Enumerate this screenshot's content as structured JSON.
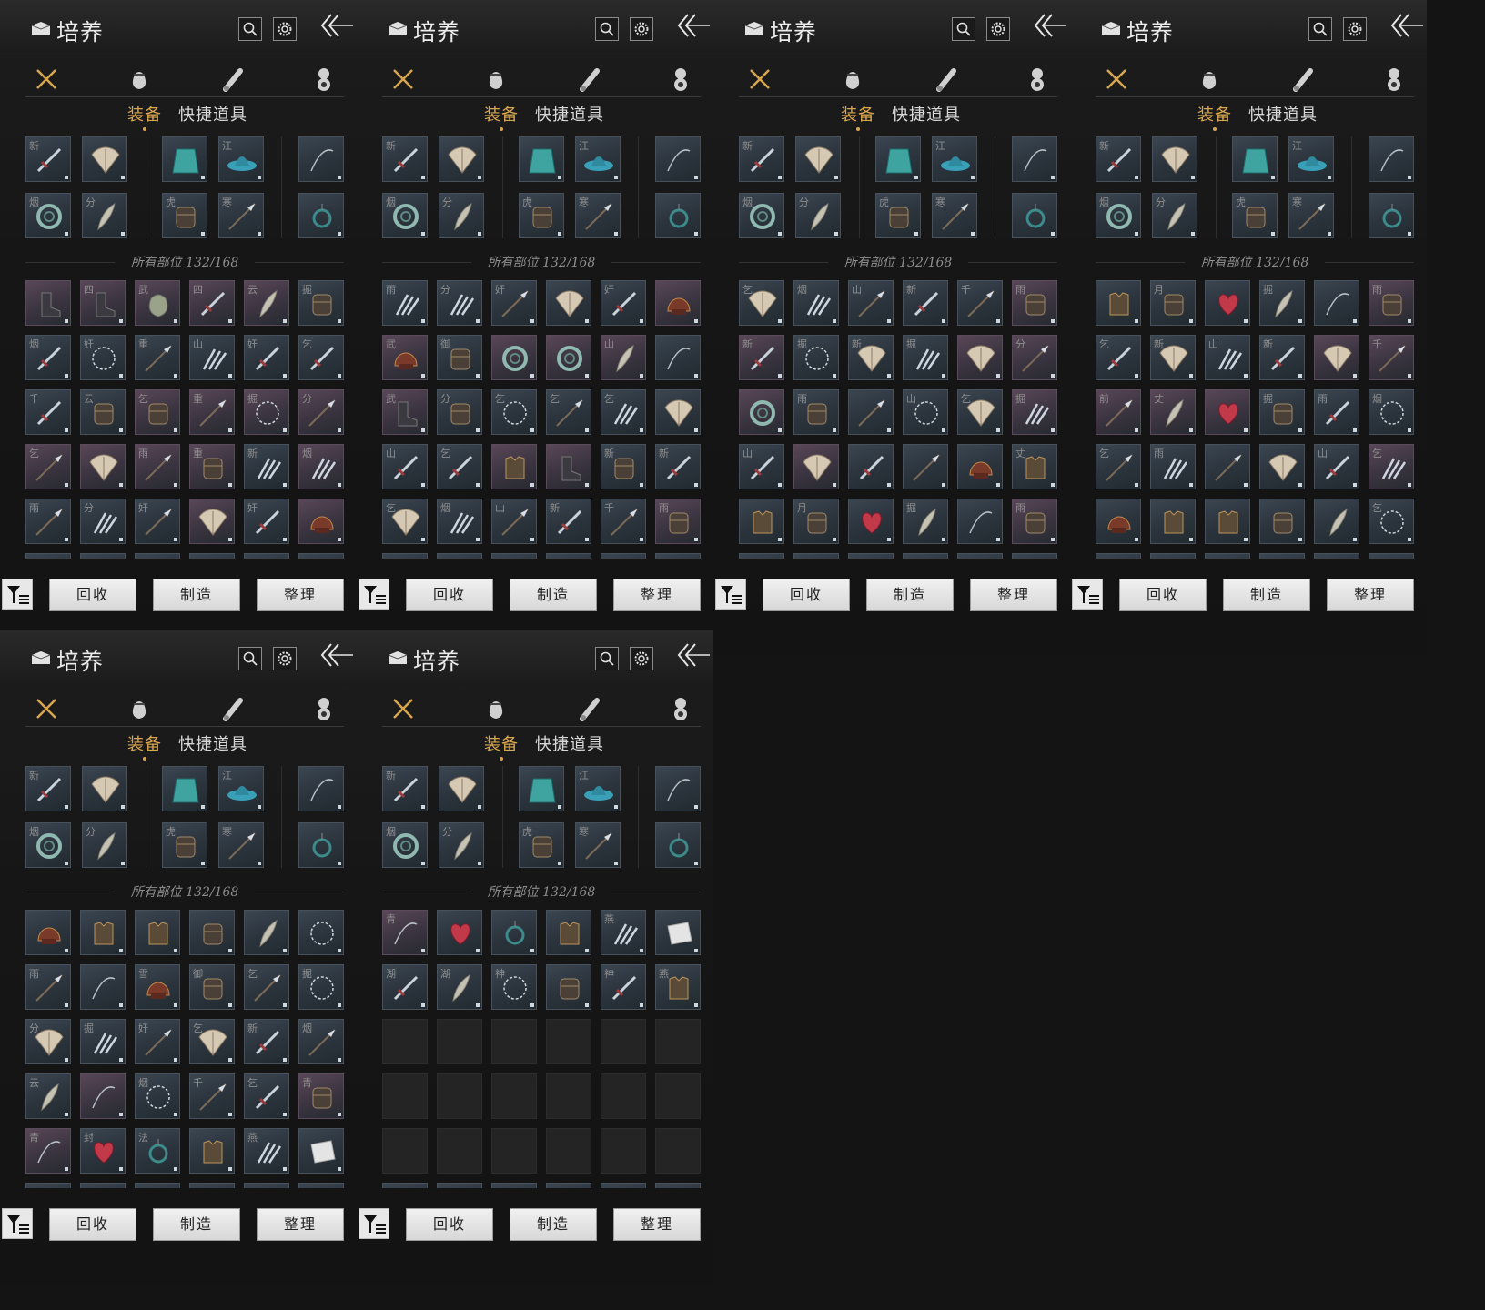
{
  "title": "培养",
  "category_tabs": [
    {
      "icon": "crossed-swords-icon",
      "active": true
    },
    {
      "icon": "pouch-icon",
      "active": false
    },
    {
      "icon": "scroll-icon",
      "active": false
    },
    {
      "icon": "emblem-icon",
      "active": false
    }
  ],
  "subtabs": {
    "equipment": "装备",
    "quick_items": "快捷道具"
  },
  "count_text": "所有部位 132/168",
  "buttons": {
    "recycle": "回收",
    "craft": "制造",
    "sort": "整理"
  },
  "colors": {
    "accent": "#d9a650",
    "slot_blue": "#3b4651",
    "slot_purple": "#5a4757"
  },
  "equipped_slots": [
    {
      "tag": "新",
      "icon": "sword-icon"
    },
    {
      "tag": "",
      "icon": "fan-icon"
    },
    {
      "tag": "",
      "icon": "cape-icon"
    },
    {
      "tag": "江",
      "icon": "hat-icon"
    },
    {
      "tag": "",
      "icon": "bow-icon"
    },
    {
      "tag": "烟",
      "icon": "ring-icon"
    },
    {
      "tag": "分",
      "icon": "feather-icon"
    },
    {
      "tag": "虎",
      "icon": "bracer-icon"
    },
    {
      "tag": "寒",
      "icon": "spear-icon"
    },
    {
      "tag": "",
      "icon": "amulet-icon"
    }
  ],
  "panels": [
    {
      "inventory": [
        {
          "t": "",
          "c": "p",
          "i": "boot-icon"
        },
        {
          "t": "四",
          "c": "p",
          "i": "boot-icon"
        },
        {
          "t": "武",
          "c": "p",
          "i": "pouch-icon"
        },
        {
          "t": "四",
          "c": "p",
          "i": "sword-icon"
        },
        {
          "t": "云",
          "c": "p",
          "i": "feather-icon"
        },
        {
          "t": "掘",
          "c": "b",
          "i": "bracer-icon"
        },
        {
          "t": "烟",
          "c": "b",
          "i": "sword-icon"
        },
        {
          "t": "奸",
          "c": "b",
          "i": "chain-icon"
        },
        {
          "t": "重",
          "c": "b",
          "i": "spear-icon"
        },
        {
          "t": "山",
          "c": "b",
          "i": "claw-icon"
        },
        {
          "t": "奸",
          "c": "b",
          "i": "sword-icon"
        },
        {
          "t": "乞",
          "c": "b",
          "i": "sword-icon"
        },
        {
          "t": "千",
          "c": "b",
          "i": "sword-icon"
        },
        {
          "t": "云",
          "c": "b",
          "i": "bracer-icon"
        },
        {
          "t": "乞",
          "c": "p",
          "i": "bracer-icon"
        },
        {
          "t": "重",
          "c": "p",
          "i": "spear-icon"
        },
        {
          "t": "掘",
          "c": "p",
          "i": "chain-icon"
        },
        {
          "t": "分",
          "c": "p",
          "i": "spear-icon"
        },
        {
          "t": "乞",
          "c": "p",
          "i": "spear-icon"
        },
        {
          "t": "",
          "c": "p",
          "i": "fan-icon"
        },
        {
          "t": "雨",
          "c": "p",
          "i": "spear-icon"
        },
        {
          "t": "重",
          "c": "p",
          "i": "bracer-icon"
        },
        {
          "t": "新",
          "c": "b",
          "i": "claw-icon"
        },
        {
          "t": "烟",
          "c": "p",
          "i": "claw-icon"
        },
        {
          "t": "雨",
          "c": "b",
          "i": "spear-icon"
        },
        {
          "t": "分",
          "c": "b",
          "i": "claw-icon"
        },
        {
          "t": "奸",
          "c": "b",
          "i": "spear-icon"
        },
        {
          "t": "",
          "c": "p",
          "i": "fan-icon"
        },
        {
          "t": "奸",
          "c": "b",
          "i": "sword-icon"
        },
        {
          "t": "",
          "c": "p",
          "i": "helmet-icon"
        }
      ]
    },
    {
      "inventory": [
        {
          "t": "雨",
          "c": "b",
          "i": "claw-icon"
        },
        {
          "t": "分",
          "c": "b",
          "i": "claw-icon"
        },
        {
          "t": "奸",
          "c": "b",
          "i": "spear-icon"
        },
        {
          "t": "",
          "c": "b",
          "i": "fan-icon"
        },
        {
          "t": "奸",
          "c": "b",
          "i": "sword-icon"
        },
        {
          "t": "",
          "c": "p",
          "i": "helmet-icon"
        },
        {
          "t": "武",
          "c": "p",
          "i": "helmet-icon"
        },
        {
          "t": "御",
          "c": "b",
          "i": "bracer-icon"
        },
        {
          "t": "",
          "c": "p",
          "i": "ring-icon"
        },
        {
          "t": "",
          "c": "p",
          "i": "ring-icon"
        },
        {
          "t": "山",
          "c": "p",
          "i": "feather-icon"
        },
        {
          "t": "",
          "c": "b",
          "i": "bow-icon"
        },
        {
          "t": "武",
          "c": "p",
          "i": "boot-icon"
        },
        {
          "t": "分",
          "c": "b",
          "i": "bracer-icon"
        },
        {
          "t": "乞",
          "c": "b",
          "i": "chain-icon"
        },
        {
          "t": "乞",
          "c": "b",
          "i": "spear-icon"
        },
        {
          "t": "乞",
          "c": "b",
          "i": "claw-icon"
        },
        {
          "t": "",
          "c": "b",
          "i": "fan-icon"
        },
        {
          "t": "山",
          "c": "b",
          "i": "sword-icon"
        },
        {
          "t": "乞",
          "c": "b",
          "i": "sword-icon"
        },
        {
          "t": "",
          "c": "p",
          "i": "armor-icon"
        },
        {
          "t": "",
          "c": "p",
          "i": "boot-icon"
        },
        {
          "t": "新",
          "c": "b",
          "i": "bracer-icon"
        },
        {
          "t": "新",
          "c": "b",
          "i": "sword-icon"
        },
        {
          "t": "乞",
          "c": "b",
          "i": "fan-icon"
        },
        {
          "t": "烟",
          "c": "b",
          "i": "claw-icon"
        },
        {
          "t": "山",
          "c": "b",
          "i": "spear-icon"
        },
        {
          "t": "新",
          "c": "b",
          "i": "sword-icon"
        },
        {
          "t": "千",
          "c": "b",
          "i": "spear-icon"
        },
        {
          "t": "雨",
          "c": "p",
          "i": "bracer-icon"
        }
      ]
    },
    {
      "inventory": [
        {
          "t": "乞",
          "c": "b",
          "i": "fan-icon"
        },
        {
          "t": "烟",
          "c": "b",
          "i": "claw-icon"
        },
        {
          "t": "山",
          "c": "b",
          "i": "spear-icon"
        },
        {
          "t": "新",
          "c": "b",
          "i": "sword-icon"
        },
        {
          "t": "千",
          "c": "b",
          "i": "spear-icon"
        },
        {
          "t": "雨",
          "c": "p",
          "i": "bracer-icon"
        },
        {
          "t": "新",
          "c": "p",
          "i": "sword-icon"
        },
        {
          "t": "掘",
          "c": "b",
          "i": "chain-icon"
        },
        {
          "t": "新",
          "c": "b",
          "i": "fan-icon"
        },
        {
          "t": "掘",
          "c": "b",
          "i": "claw-icon"
        },
        {
          "t": "",
          "c": "p",
          "i": "fan-icon"
        },
        {
          "t": "分",
          "c": "p",
          "i": "spear-icon"
        },
        {
          "t": "",
          "c": "p",
          "i": "ring-icon"
        },
        {
          "t": "雨",
          "c": "b",
          "i": "bracer-icon"
        },
        {
          "t": "",
          "c": "b",
          "i": "spear-icon"
        },
        {
          "t": "山",
          "c": "b",
          "i": "chain-icon"
        },
        {
          "t": "乞",
          "c": "b",
          "i": "fan-icon"
        },
        {
          "t": "掘",
          "c": "p",
          "i": "claw-icon"
        },
        {
          "t": "山",
          "c": "b",
          "i": "sword-icon"
        },
        {
          "t": "",
          "c": "p",
          "i": "fan-icon"
        },
        {
          "t": "",
          "c": "b",
          "i": "sword-icon"
        },
        {
          "t": "",
          "c": "b",
          "i": "spear-icon"
        },
        {
          "t": "",
          "c": "b",
          "i": "helmet-icon"
        },
        {
          "t": "丈",
          "c": "b",
          "i": "armor-icon"
        },
        {
          "t": "",
          "c": "b",
          "i": "armor-icon"
        },
        {
          "t": "月",
          "c": "b",
          "i": "bracer-icon"
        },
        {
          "t": "",
          "c": "b",
          "i": "heart-icon"
        },
        {
          "t": "掘",
          "c": "b",
          "i": "feather-icon"
        },
        {
          "t": "",
          "c": "b",
          "i": "bow-icon"
        },
        {
          "t": "雨",
          "c": "p",
          "i": "bracer-icon"
        }
      ]
    },
    {
      "inventory": [
        {
          "t": "",
          "c": "b",
          "i": "armor-icon"
        },
        {
          "t": "月",
          "c": "b",
          "i": "bracer-icon"
        },
        {
          "t": "",
          "c": "b",
          "i": "heart-icon"
        },
        {
          "t": "掘",
          "c": "b",
          "i": "feather-icon"
        },
        {
          "t": "",
          "c": "b",
          "i": "bow-icon"
        },
        {
          "t": "雨",
          "c": "p",
          "i": "bracer-icon"
        },
        {
          "t": "乞",
          "c": "b",
          "i": "sword-icon"
        },
        {
          "t": "新",
          "c": "b",
          "i": "fan-icon"
        },
        {
          "t": "山",
          "c": "b",
          "i": "claw-icon"
        },
        {
          "t": "新",
          "c": "b",
          "i": "sword-icon"
        },
        {
          "t": "",
          "c": "p",
          "i": "fan-icon"
        },
        {
          "t": "千",
          "c": "p",
          "i": "spear-icon"
        },
        {
          "t": "前",
          "c": "p",
          "i": "spear-icon"
        },
        {
          "t": "丈",
          "c": "p",
          "i": "feather-icon"
        },
        {
          "t": "",
          "c": "p",
          "i": "heart-icon"
        },
        {
          "t": "掘",
          "c": "b",
          "i": "bracer-icon"
        },
        {
          "t": "雨",
          "c": "b",
          "i": "sword-icon"
        },
        {
          "t": "烟",
          "c": "b",
          "i": "chain-icon"
        },
        {
          "t": "乞",
          "c": "b",
          "i": "spear-icon"
        },
        {
          "t": "雨",
          "c": "b",
          "i": "claw-icon"
        },
        {
          "t": "",
          "c": "b",
          "i": "spear-icon"
        },
        {
          "t": "",
          "c": "b",
          "i": "fan-icon"
        },
        {
          "t": "山",
          "c": "b",
          "i": "sword-icon"
        },
        {
          "t": "乞",
          "c": "p",
          "i": "claw-icon"
        },
        {
          "t": "",
          "c": "b",
          "i": "helmet-icon"
        },
        {
          "t": "",
          "c": "b",
          "i": "armor-icon"
        },
        {
          "t": "",
          "c": "b",
          "i": "armor-icon"
        },
        {
          "t": "",
          "c": "b",
          "i": "bracer-icon"
        },
        {
          "t": "",
          "c": "b",
          "i": "feather-icon"
        },
        {
          "t": "乞",
          "c": "b",
          "i": "chain-icon"
        }
      ]
    },
    {
      "inventory": [
        {
          "t": "",
          "c": "b",
          "i": "helmet-icon"
        },
        {
          "t": "",
          "c": "b",
          "i": "armor-icon"
        },
        {
          "t": "",
          "c": "b",
          "i": "armor-icon"
        },
        {
          "t": "",
          "c": "b",
          "i": "bracer-icon"
        },
        {
          "t": "",
          "c": "b",
          "i": "feather-icon"
        },
        {
          "t": "",
          "c": "b",
          "i": "chain-icon"
        },
        {
          "t": "雨",
          "c": "b",
          "i": "spear-icon"
        },
        {
          "t": "",
          "c": "b",
          "i": "bow-icon"
        },
        {
          "t": "雪",
          "c": "b",
          "i": "helmet-icon"
        },
        {
          "t": "御",
          "c": "b",
          "i": "bracer-icon"
        },
        {
          "t": "乞",
          "c": "b",
          "i": "spear-icon"
        },
        {
          "t": "掘",
          "c": "b",
          "i": "chain-icon"
        },
        {
          "t": "分",
          "c": "b",
          "i": "fan-icon"
        },
        {
          "t": "掘",
          "c": "b",
          "i": "claw-icon"
        },
        {
          "t": "奸",
          "c": "b",
          "i": "spear-icon"
        },
        {
          "t": "乞",
          "c": "b",
          "i": "fan-icon"
        },
        {
          "t": "新",
          "c": "b",
          "i": "sword-icon"
        },
        {
          "t": "烟",
          "c": "b",
          "i": "spear-icon"
        },
        {
          "t": "云",
          "c": "b",
          "i": "feather-icon"
        },
        {
          "t": "",
          "c": "p",
          "i": "bow-icon"
        },
        {
          "t": "烟",
          "c": "b",
          "i": "chain-icon"
        },
        {
          "t": "千",
          "c": "b",
          "i": "spear-icon"
        },
        {
          "t": "乞",
          "c": "b",
          "i": "sword-icon"
        },
        {
          "t": "青",
          "c": "p",
          "i": "bracer-icon"
        },
        {
          "t": "青",
          "c": "p",
          "i": "bow-icon"
        },
        {
          "t": "封",
          "c": "b",
          "i": "heart-icon"
        },
        {
          "t": "法",
          "c": "b",
          "i": "amulet-icon"
        },
        {
          "t": "",
          "c": "b",
          "i": "armor-icon"
        },
        {
          "t": "燕",
          "c": "b",
          "i": "claw-icon"
        },
        {
          "t": "",
          "c": "b",
          "i": "cloth-icon"
        }
      ]
    },
    {
      "inventory": [
        {
          "t": "青",
          "c": "p",
          "i": "bow-icon"
        },
        {
          "t": "",
          "c": "b",
          "i": "heart-icon"
        },
        {
          "t": "",
          "c": "b",
          "i": "amulet-icon"
        },
        {
          "t": "",
          "c": "b",
          "i": "armor-icon"
        },
        {
          "t": "燕",
          "c": "b",
          "i": "claw-icon"
        },
        {
          "t": "",
          "c": "b",
          "i": "cloth-icon"
        },
        {
          "t": "湖",
          "c": "b",
          "i": "sword-icon"
        },
        {
          "t": "湖",
          "c": "b",
          "i": "feather-icon"
        },
        {
          "t": "神",
          "c": "b",
          "i": "chain-icon"
        },
        {
          "t": "",
          "c": "b",
          "i": "bracer-icon"
        },
        {
          "t": "神",
          "c": "b",
          "i": "sword-icon"
        },
        {
          "t": "燕",
          "c": "b",
          "i": "armor-icon"
        },
        {
          "t": "",
          "c": "e",
          "i": ""
        },
        {
          "t": "",
          "c": "e",
          "i": ""
        },
        {
          "t": "",
          "c": "e",
          "i": ""
        },
        {
          "t": "",
          "c": "e",
          "i": ""
        },
        {
          "t": "",
          "c": "e",
          "i": ""
        },
        {
          "t": "",
          "c": "e",
          "i": ""
        },
        {
          "t": "",
          "c": "e",
          "i": ""
        },
        {
          "t": "",
          "c": "e",
          "i": ""
        },
        {
          "t": "",
          "c": "e",
          "i": ""
        },
        {
          "t": "",
          "c": "e",
          "i": ""
        },
        {
          "t": "",
          "c": "e",
          "i": ""
        },
        {
          "t": "",
          "c": "e",
          "i": ""
        },
        {
          "t": "",
          "c": "e",
          "i": ""
        },
        {
          "t": "",
          "c": "e",
          "i": ""
        },
        {
          "t": "",
          "c": "e",
          "i": ""
        },
        {
          "t": "",
          "c": "e",
          "i": ""
        },
        {
          "t": "",
          "c": "e",
          "i": ""
        },
        {
          "t": "",
          "c": "e",
          "i": ""
        }
      ]
    }
  ]
}
